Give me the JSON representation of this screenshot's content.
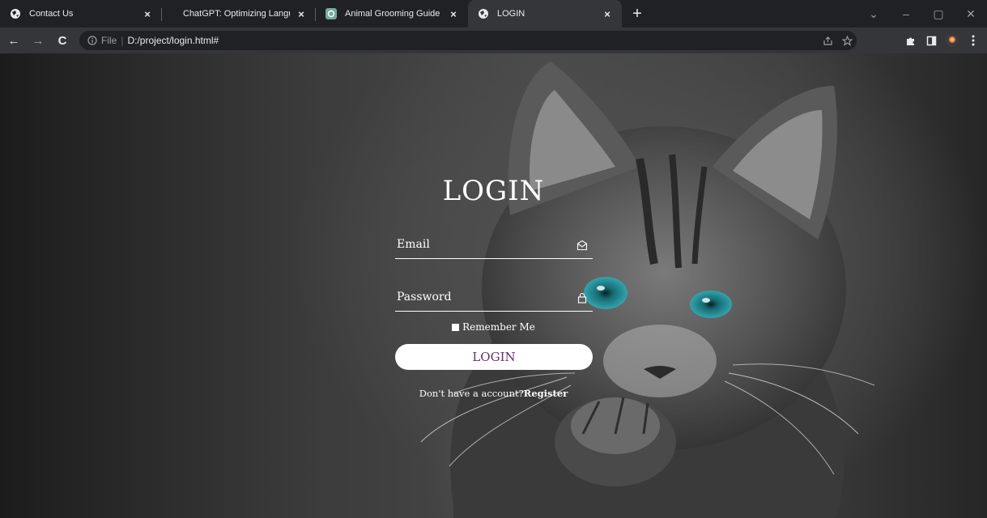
{
  "browser": {
    "tabs": [
      {
        "title": "Contact Us",
        "close": "×",
        "favicon": "globe-icon",
        "active": false
      },
      {
        "title": "ChatGPT: Optimizing Language M",
        "close": "×",
        "favicon": "none",
        "active": false
      },
      {
        "title": "Animal Grooming Guide",
        "close": "×",
        "favicon": "chatgpt-icon",
        "active": false
      },
      {
        "title": "LOGIN",
        "close": "×",
        "favicon": "globe-icon",
        "active": true
      }
    ],
    "new_tab": "+",
    "window_controls": {
      "dropdown": "⌄",
      "minimize": "–",
      "restore": "▢",
      "close": "✕"
    },
    "toolbar": {
      "back": "←",
      "forward": "→",
      "reload": "C",
      "scheme": "File",
      "url": "D:/project/login.html#"
    }
  },
  "page": {
    "title": "LOGIN",
    "email_placeholder": "Email",
    "password_placeholder": "Password",
    "remember_label": "Remember Me",
    "login_button": "LOGIN",
    "register_prompt": "Don't have a account?",
    "register_link": "Register"
  },
  "colors": {
    "chrome_bg": "#202124",
    "toolbar_bg": "#35363a",
    "button_text": "#6a2c6e",
    "cat_eye": "#1e7d86"
  }
}
